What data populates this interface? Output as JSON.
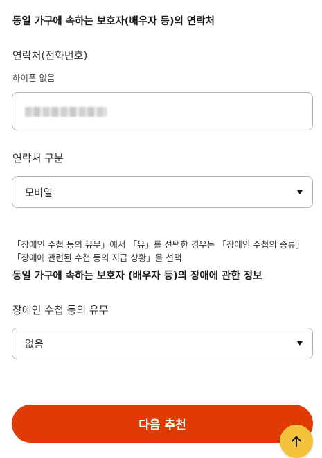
{
  "household_contact": {
    "title": "동일 가구에 속하는 보호자(배우자 등)의 연락처",
    "phone_label": "연락처(전화번호)",
    "phone_hint": "하이픈 없음",
    "contact_type_label": "연락처 구분",
    "contact_type_value": "모바일"
  },
  "disability_section": {
    "note": "「장애인 수첩 등의 유무」에서 「유」를 선택한 경우는 「장애인 수첩의 종류」 「장애에 관련된 수첩 등의 지급 상황」을 선택",
    "title": "동일 가구에 속하는 보호자 (배우자 등)의 장애에 관한 정보",
    "notebook_label": "장애인 수첩 등의 유무",
    "notebook_value": "없음"
  },
  "actions": {
    "next_label": "다음 추천"
  },
  "icons": {
    "dropdown": "caret-down-icon",
    "scroll_top": "arrow-up-icon"
  },
  "colors": {
    "primary_button": "#e03a05",
    "scroll_top_button": "#f5c33b"
  }
}
